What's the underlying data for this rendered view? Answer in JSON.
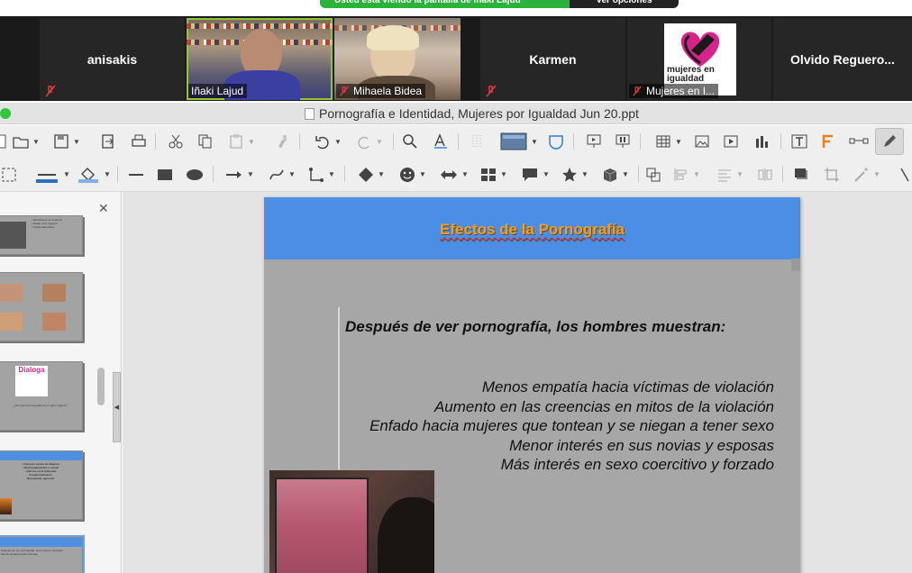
{
  "share_banner": {
    "message": "Usted está viendo la pantalla de Iñaki Lajud",
    "options_label": "Ver opciones"
  },
  "participants": [
    {
      "name": "anisakis",
      "muted": true,
      "video": false
    },
    {
      "name": "Iñaki Lajud",
      "muted": false,
      "video": true,
      "speaking": true
    },
    {
      "name": "Mihaela Bidea",
      "muted": true,
      "video": true
    },
    {
      "name": "Karmen",
      "muted": true,
      "video": false
    },
    {
      "name": "Mujeres en I...",
      "muted": true,
      "video": false,
      "logo_text": "mujeres en igualdad"
    },
    {
      "name": "Olvido  Reguero...",
      "muted": false,
      "video": false
    }
  ],
  "window": {
    "title": "Pornografía e Identidad, Mujeres por Igualdad Jun 20.ppt"
  },
  "colors": {
    "slide_header": "#4a8ee6",
    "slide_title": "#f39c1f",
    "slide_bg": "#a7a7a7",
    "active_speaker": "#8fc832"
  },
  "slide": {
    "title": "Efectos de la Pornografía",
    "lead": "Después de ver pornografía, los hombres muestran:",
    "bullets": [
      "Menos empatía hacia víctimas de violación",
      "Aumento en las creencias en mitos de la violación",
      "Enfado hacia mujeres que tontean y se niegan a tener sexo",
      "Menor interés en sus novias y esposas",
      "Más interés en sexo coercitivo y forzado"
    ]
  },
  "sorter": {
    "thumbnails": [
      {
        "lines": [
          "• Aumenta en el consumo",
          "• Dañar a las mujeres",
          "• Cosas adornadas"
        ]
      },
      {
        "lines": []
      },
      {
        "lines": [
          "Dialoga",
          "¿Por qué la pornografía es un gran negocio?"
        ]
      },
      {
        "lines": [
          "• Violencia contra las Mujeres",
          "• Deshumanización y sexual",
          "• Efectos en la Intimidad",
          "Condicionamiento",
          "Masoquista, agresión"
        ]
      },
      {
        "lines": [
          "Después de ver pornografía, los hombres muestran",
          "Menos empatía hacia víctimas"
        ],
        "selected": true
      }
    ]
  }
}
